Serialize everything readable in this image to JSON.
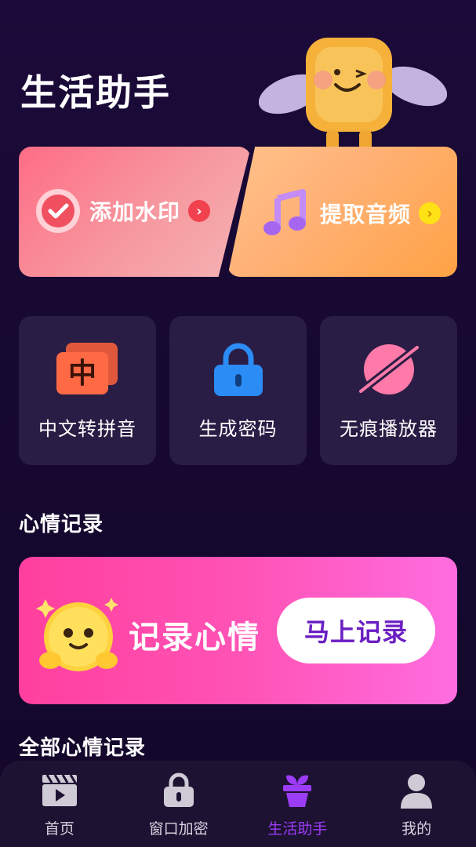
{
  "header": {
    "title": "生活助手"
  },
  "feature_cards": [
    {
      "label": "添加水印",
      "arrow": "›"
    },
    {
      "label": "提取音频",
      "arrow": "›"
    }
  ],
  "tools": [
    {
      "label": "中文转拼音",
      "icon_char": "中"
    },
    {
      "label": "生成密码"
    },
    {
      "label": "无痕播放器"
    }
  ],
  "mood_section": {
    "title": "心情记录",
    "card_label": "记录心情",
    "button_label": "马上记录"
  },
  "all_records": {
    "title": "全部心情记录"
  },
  "nav": [
    {
      "label": "首页"
    },
    {
      "label": "窗口加密"
    },
    {
      "label": "生活助手"
    },
    {
      "label": "我的"
    }
  ],
  "colors": {
    "background": "#170932",
    "accent": "#9b3cf7",
    "watermark_card": "#ff6d86",
    "audio_card": "#ffa244",
    "mood_card": "#ff55b8",
    "tile": "#2a1d45"
  }
}
